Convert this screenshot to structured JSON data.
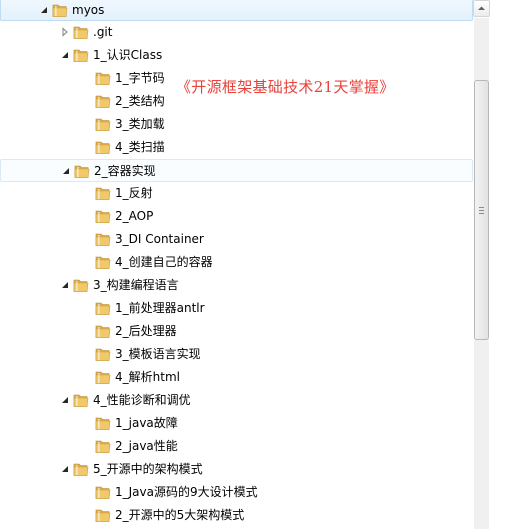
{
  "tree": {
    "items": [
      {
        "label": "myos",
        "level": 0,
        "expanded": true,
        "selected": true
      },
      {
        "label": ".git",
        "level": 1,
        "expanded": false
      },
      {
        "label": "1_认识Class",
        "level": 1,
        "expanded": true
      },
      {
        "label": "1_字节码",
        "level": 2
      },
      {
        "label": "2_类结构",
        "level": 2
      },
      {
        "label": "3_类加载",
        "level": 2
      },
      {
        "label": "4_类扫描",
        "level": 2
      },
      {
        "label": "2_容器实现",
        "level": 1,
        "expanded": true,
        "hover": true
      },
      {
        "label": "1_反射",
        "level": 2
      },
      {
        "label": "2_AOP",
        "level": 2
      },
      {
        "label": "3_DI Container",
        "level": 2
      },
      {
        "label": "4_创建自己的容器",
        "level": 2
      },
      {
        "label": "3_构建编程语言",
        "level": 1,
        "expanded": true
      },
      {
        "label": "1_前处理器antlr",
        "level": 2
      },
      {
        "label": "2_后处理器",
        "level": 2
      },
      {
        "label": "3_模板语言实现",
        "level": 2
      },
      {
        "label": "4_解析html",
        "level": 2
      },
      {
        "label": "4_性能诊断和调优",
        "level": 1,
        "expanded": true
      },
      {
        "label": "1_java故障",
        "level": 2
      },
      {
        "label": "2_java性能",
        "level": 2
      },
      {
        "label": "5_开源中的架构模式",
        "level": 1,
        "expanded": true
      },
      {
        "label": "1_Java源码的9大设计模式",
        "level": 2
      },
      {
        "label": "2_开源中的5大架构模式",
        "level": 2
      }
    ]
  },
  "banner": {
    "text": "《开源框架基础技术21天掌握》",
    "color": "#e8423a"
  },
  "scrollbar": {
    "position_fraction": 0.28
  },
  "colors": {
    "folder_front": "#f2c96a",
    "folder_back": "#dcae4e",
    "selection": "#e2f1fc",
    "selection_border": "#bedcf2",
    "arrow": "#262626",
    "arrow_collapsed": "#808080"
  }
}
